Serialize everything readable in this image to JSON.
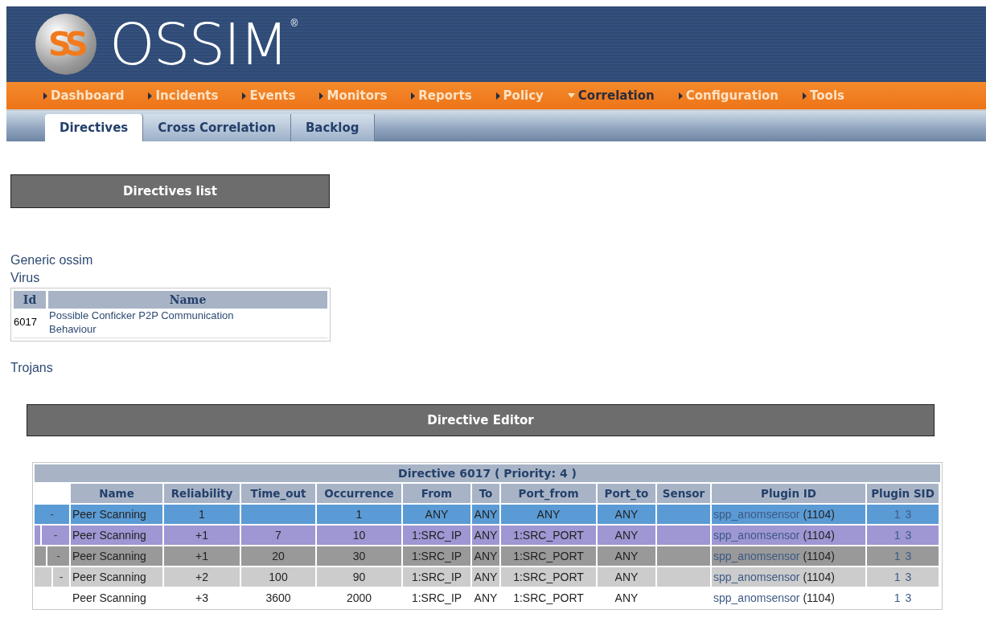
{
  "logo": {
    "mark": "SS",
    "text": "OSSIM",
    "reg": "®"
  },
  "nav": [
    {
      "label": "Dashboard",
      "selected": false
    },
    {
      "label": "Incidents",
      "selected": false
    },
    {
      "label": "Events",
      "selected": false
    },
    {
      "label": "Monitors",
      "selected": false
    },
    {
      "label": "Reports",
      "selected": false
    },
    {
      "label": "Policy",
      "selected": false
    },
    {
      "label": "Correlation",
      "selected": true
    },
    {
      "label": "Configuration",
      "selected": false
    },
    {
      "label": "Tools",
      "selected": false
    }
  ],
  "tabs": [
    {
      "label": "Directives",
      "selected": true
    },
    {
      "label": "Cross Correlation",
      "selected": false
    },
    {
      "label": "Backlog",
      "selected": false
    }
  ],
  "directives_list": {
    "title": "Directives list",
    "categories": [
      {
        "label": "Generic ossim"
      },
      {
        "label": "Virus",
        "table": {
          "columns": [
            "Id",
            "Name"
          ],
          "rows": [
            {
              "id": "6017",
              "name": "Possible Conficker P2P Communication Behaviour"
            }
          ]
        }
      },
      {
        "label": "Trojans"
      }
    ]
  },
  "editor": {
    "title": "Directive Editor",
    "table_title": "Directive 6017 ( Priority: 4 )",
    "columns": [
      "Name",
      "Reliability",
      "Time_out",
      "Occurrence",
      "From",
      "To",
      "Port_from",
      "Port_to",
      "Sensor",
      "Plugin ID",
      "Plugin SID"
    ],
    "rules": [
      {
        "toggle": "-",
        "color": "#5b9bd5",
        "name": "Peer Scanning",
        "reliability": "1",
        "occurrence": "1",
        "from": "ANY",
        "to": "ANY",
        "port_from": "ANY",
        "port_to": "ANY",
        "plugin": "spp_anomsensor",
        "plugin_num": "(1104)",
        "sids": [
          "1",
          "3"
        ],
        "children": [
          {
            "toggle": "-",
            "color": "#9e97d3",
            "name": "Peer Scanning",
            "reliability": "+1",
            "time_out": "7",
            "occurrence": "10",
            "from": "1:SRC_IP",
            "to": "ANY",
            "port_from": "1:SRC_PORT",
            "port_to": "ANY",
            "plugin": "spp_anomsensor",
            "plugin_num": "(1104)",
            "sids": [
              "1",
              "3"
            ],
            "children": [
              {
                "toggle": "-",
                "color": "#999999",
                "name": "Peer Scanning",
                "reliability": "+1",
                "time_out": "20",
                "occurrence": "30",
                "from": "1:SRC_IP",
                "to": "ANY",
                "port_from": "1:SRC_PORT",
                "port_to": "ANY",
                "plugin": "spp_anomsensor",
                "plugin_num": "(1104)",
                "sids": [
                  "1",
                  "3"
                ],
                "children": [
                  {
                    "toggle": "-",
                    "color": "#cccccc",
                    "name": "Peer Scanning",
                    "reliability": "+2",
                    "time_out": "100",
                    "occurrence": "90",
                    "from": "1:SRC_IP",
                    "to": "ANY",
                    "port_from": "1:SRC_PORT",
                    "port_to": "ANY",
                    "plugin": "spp_anomsensor",
                    "plugin_num": "(1104)",
                    "sids": [
                      "1",
                      "3"
                    ],
                    "children": [
                      {
                        "color": "#ffffff",
                        "name": "Peer Scanning",
                        "reliability": "+3",
                        "time_out": "3600",
                        "occurrence": "2000",
                        "from": "1:SRC_IP",
                        "to": "ANY",
                        "port_from": "1:SRC_PORT",
                        "port_to": "ANY",
                        "plugin": "spp_anomsensor",
                        "plugin_num": "(1104)",
                        "sids": [
                          "1",
                          "3"
                        ]
                      }
                    ]
                  }
                ]
              }
            ]
          }
        ]
      }
    ]
  }
}
